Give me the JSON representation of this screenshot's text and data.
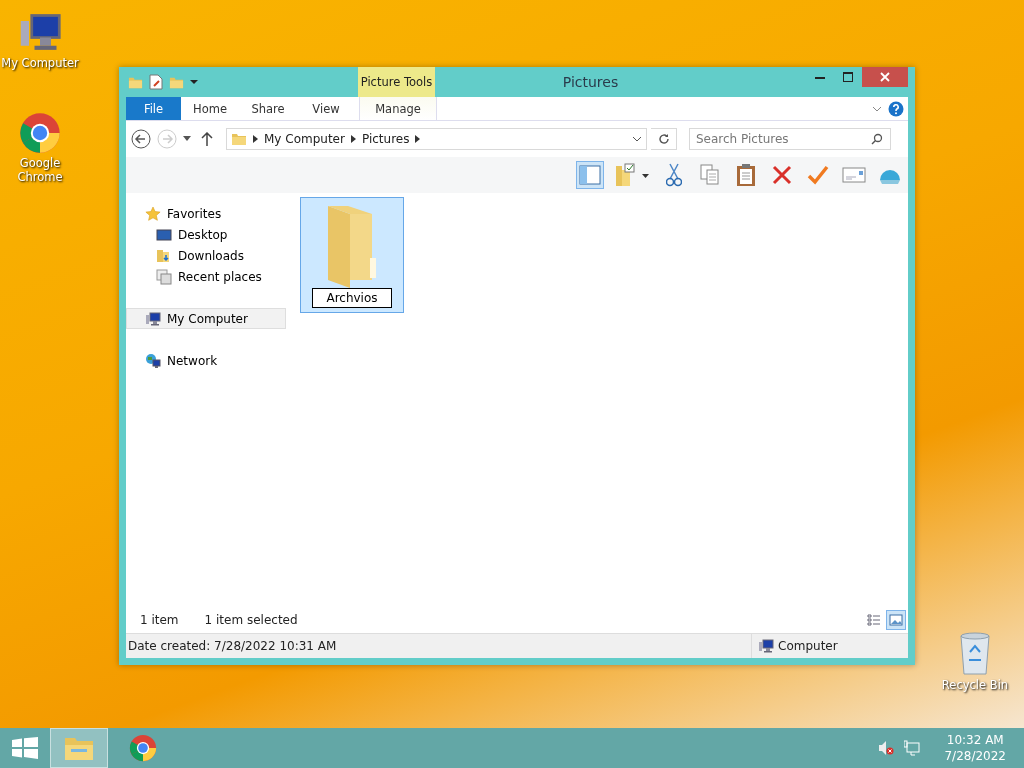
{
  "desktop_icons": [
    {
      "label": "My Computer",
      "kind": "computer"
    },
    {
      "label": "Google Chrome",
      "kind": "browser"
    },
    {
      "label": "Recycle Bin",
      "kind": "recycle"
    }
  ],
  "window": {
    "title": "Pictures",
    "context_label": "Picture Tools",
    "ribbon_tabs": [
      {
        "label": "File",
        "kind": "file"
      },
      {
        "label": "Home",
        "kind": "tab"
      },
      {
        "label": "Share",
        "kind": "tab"
      },
      {
        "label": "View",
        "kind": "tab"
      },
      {
        "label": "Manage",
        "kind": "context"
      }
    ],
    "address": {
      "path": [
        "My Computer",
        "Pictures"
      ],
      "search_placeholder": "Search Pictures"
    },
    "nav": [
      {
        "label": "Favorites",
        "kind": "star",
        "selected": false,
        "children": [
          {
            "label": "Desktop",
            "kind": "desktop",
            "selected": false
          },
          {
            "label": "Downloads",
            "kind": "downloads",
            "selected": false
          },
          {
            "label": "Recent places",
            "kind": "recent",
            "selected": false
          }
        ]
      },
      {
        "label": "My Computer",
        "kind": "computer",
        "selected": true
      },
      {
        "label": "Network",
        "kind": "network",
        "selected": false
      }
    ],
    "items": [
      {
        "name": "Archvios",
        "selected": true,
        "editing": true
      }
    ],
    "status": {
      "count": "1 item",
      "selection": "1 item selected"
    },
    "views": [
      {
        "kind": "details",
        "selected": false
      },
      {
        "kind": "large",
        "selected": true
      }
    ],
    "details": {
      "text": "Date created: 7/28/2022 10:31 AM",
      "location": "Computer"
    }
  },
  "taskbar": {
    "apps": [
      {
        "kind": "explorer",
        "selected": true
      },
      {
        "kind": "browser",
        "selected": false
      }
    ],
    "muted": true,
    "time": "10:32 AM",
    "date": "7/28/2022"
  }
}
